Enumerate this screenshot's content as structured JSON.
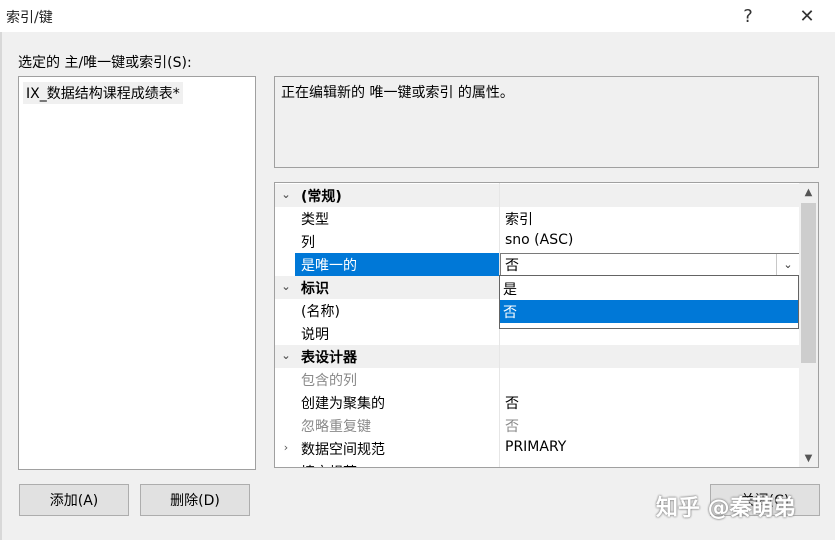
{
  "window": {
    "title": "索引/键",
    "help_label": "?",
    "close_label": "✕"
  },
  "list": {
    "label": "选定的 主/唯一键或索引(S):",
    "items": [
      "IX_数据结构课程成绩表*"
    ]
  },
  "description": "正在编辑新的 唯一键或索引 的属性。",
  "grid": {
    "rows": [
      {
        "type": "category",
        "expander": "⌄",
        "name": "(常规)"
      },
      {
        "type": "prop",
        "name": "类型",
        "value": "索引"
      },
      {
        "type": "prop",
        "name": "列",
        "value": "sno (ASC)"
      },
      {
        "type": "prop",
        "name": "是唯一的",
        "value": "否",
        "selected": true
      },
      {
        "type": "category",
        "expander": "⌄",
        "name": "标识"
      },
      {
        "type": "prop",
        "name": "(名称)",
        "value": ""
      },
      {
        "type": "prop",
        "name": "说明",
        "value": ""
      },
      {
        "type": "category",
        "expander": "⌄",
        "name": "表设计器"
      },
      {
        "type": "prop",
        "name": "包含的列",
        "value": "",
        "disabled": true
      },
      {
        "type": "prop",
        "name": "创建为聚集的",
        "value": "否"
      },
      {
        "type": "prop",
        "name": "忽略重复键",
        "value": "否",
        "disabled": true
      },
      {
        "type": "prop",
        "expander": "›",
        "name": "数据空间规范",
        "value": "PRIMARY"
      },
      {
        "type": "prop",
        "expander": "›",
        "name": "填充规范",
        "value": ""
      }
    ],
    "dropdown_options": [
      "是",
      "否"
    ],
    "dropdown_highlighted": "否",
    "scroll_up": "▲",
    "scroll_down": "▼",
    "dropdown_arrow": "⌄"
  },
  "buttons": {
    "add": "添加(A)",
    "delete": "删除(D)",
    "close": "关闭(C)"
  },
  "watermark": "知乎 @秦萌弟"
}
